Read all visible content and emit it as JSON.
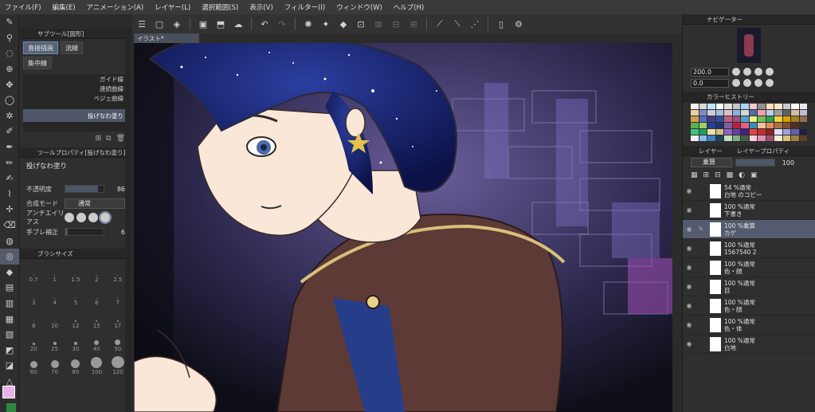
{
  "menu": [
    "ファイル(F)",
    "編集(E)",
    "アニメーション(A)",
    "レイヤー(L)",
    "選択範囲(S)",
    "表示(V)",
    "フィルター(I)",
    "ウィンドウ(W)",
    "ヘルプ(H)"
  ],
  "canvas_tab": "イラスト*",
  "subtool": {
    "header": "サブツール[図形]",
    "tabs": [
      "直接描画",
      "流線",
      "集中線"
    ],
    "brushes": [
      "ガイド線",
      "連続曲線",
      "ベジェ曲線",
      "投げなわ塗り"
    ]
  },
  "tool_property": {
    "header": "ツールプロパティ[投げなわ塗り]",
    "tool_name": "投げなわ塗り",
    "opacity_label": "不透明度",
    "opacity_value": "86",
    "blend_label": "合成モード",
    "blend_value": "通常",
    "antialias_label": "アンチエイリアス",
    "stabilization_label": "手ブレ補正",
    "stabilization_value": "6"
  },
  "brush_size": {
    "header": "ブラシサイズ",
    "sizes": [
      "0.7",
      "1",
      "1.5",
      "2",
      "2.5",
      "3",
      "4",
      "5",
      "6",
      "7",
      "8",
      "10",
      "12",
      "15",
      "17",
      "20",
      "25",
      "30",
      "40",
      "50",
      "60",
      "70",
      "80",
      "100",
      "120"
    ]
  },
  "navigator": {
    "header": "ナビゲーター",
    "zoom": "200.0",
    "angle": "0.0"
  },
  "color_history": {
    "header": "カラーヒストリー",
    "colors": [
      "#f2f2f2",
      "#d9d9d9",
      "#b8e6ff",
      "#ffffff",
      "#e0e0e0",
      "#c6c6c6",
      "#9fd7ff",
      "#f7c3d2",
      "#8f8f8f",
      "#ffe0b8",
      "#ffe8c8",
      "#c8c8c8",
      "#ffffff",
      "#e9e9e9",
      "#e8cfa0",
      "#7d8cc8",
      "#c7ced8",
      "#a7bfe0",
      "#e0c0c8",
      "#8fb0e0",
      "#d6d6d6",
      "#4f6fa0",
      "#f0a0b0",
      "#c0d0e8",
      "#a0a0a0",
      "#606060",
      "#d0c0a0",
      "#c0c0d0",
      "#d4a050",
      "#5070c0",
      "#404080",
      "#3050a0",
      "#c06080",
      "#a05080",
      "#50a0d0",
      "#f0f080",
      "#70c050",
      "#30a050",
      "#f0d040",
      "#e0a000",
      "#a08020",
      "#907050",
      "#60b050",
      "#a0d060",
      "#2040a0",
      "#203070",
      "#8060a0",
      "#c02040",
      "#e06080",
      "#3090c0",
      "#f0c0a0",
      "#e09060",
      "#b07040",
      "#805030",
      "#503020",
      "#303030",
      "#40c080",
      "#20a060",
      "#f0e0a0",
      "#d0c080",
      "#9060c0",
      "#6040a0",
      "#402080",
      "#f04040",
      "#c03030",
      "#902020",
      "#e0e0ff",
      "#a0a0e0",
      "#6060b0",
      "#202040",
      "#f0f0f0",
      "#80c0f0",
      "#4080c0",
      "#204060",
      "#c0e0c0",
      "#80b080",
      "#406040",
      "#ffd0e0",
      "#e090b0",
      "#a05070",
      "#f8f0d0",
      "#e0c080",
      "#a08040",
      "#604020"
    ]
  },
  "layer_panel": {
    "tab1": "レイヤー",
    "tab2": "レイヤープロパティ",
    "blend": "乗算",
    "opacity": "100",
    "layers": [
      {
        "line1": "54 %通常",
        "line2": "白地 のコピー"
      },
      {
        "line1": "100 %通常",
        "line2": "下書き"
      },
      {
        "line1": "100 %乗算",
        "line2": "カゲ"
      },
      {
        "line1": "100 %通常",
        "line2": "1567540 2"
      },
      {
        "line1": "100 %通常",
        "line2": "色・顔"
      },
      {
        "line1": "100 %通常",
        "line2": "目"
      },
      {
        "line1": "100 %通常",
        "line2": "色・顔"
      },
      {
        "line1": "100 %通常",
        "line2": "色・体"
      },
      {
        "line1": "100 %通常",
        "line2": "白地"
      }
    ]
  }
}
